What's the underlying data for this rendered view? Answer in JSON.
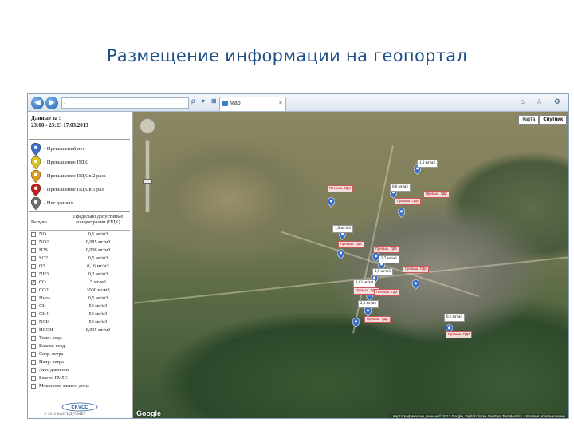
{
  "slide": {
    "title": "Размещение информации на геопортал"
  },
  "browser": {
    "address": ":",
    "address_icons": "ρ ▾ ⊠ ↻ ×",
    "tab_label": "Map",
    "tab_close": "×",
    "window_icons": "⌂ ☆ ⚙"
  },
  "legend": {
    "date_label": "Данные за :",
    "date_value": "23:00 - 23:23 17.03.2013",
    "items": [
      {
        "label": "- Превышений нет",
        "color": "#3a6fc9"
      },
      {
        "label": "- Превышение ПДК",
        "color": "#d9c21a"
      },
      {
        "label": "- Превышение ПДК в 2 раза",
        "color": "#e09a1a"
      },
      {
        "label": "- Превышение ПДК в 5 раз",
        "color": "#c6221c"
      },
      {
        "label": "- Нет данных",
        "color": "#6e6e6e"
      }
    ]
  },
  "pdk_table": {
    "col1": "Вещ-во",
    "col2": "Предельно допустимые концентрации (ПДК)",
    "rows": [
      {
        "name": "NO",
        "value": "0,1 мг/м3",
        "checked": false
      },
      {
        "name": "NO2",
        "value": "0,085 мг/м3",
        "checked": false
      },
      {
        "name": "H2S",
        "value": "0,008 мг/м3",
        "checked": false
      },
      {
        "name": "SO2",
        "value": "0,5 мг/м3",
        "checked": false
      },
      {
        "name": "O3",
        "value": "0,16 мг/м3",
        "checked": false
      },
      {
        "name": "NH3",
        "value": "0,2 мг/м3",
        "checked": false
      },
      {
        "name": "CO",
        "value": "5 мг/м3",
        "checked": true
      },
      {
        "name": "CO2",
        "value": "1000 мг/м3",
        "checked": false
      },
      {
        "name": "Пыль",
        "value": "0,5 мг/м3",
        "checked": false
      },
      {
        "name": "CH",
        "value": "50 мг/м3",
        "checked": false
      },
      {
        "name": "CH4",
        "value": "50 мг/м3",
        "checked": false
      },
      {
        "name": "NCH",
        "value": "50 мг/м3",
        "checked": false
      },
      {
        "name": "НСОН",
        "value": "0,035 мг/м3",
        "checked": false
      },
      {
        "name": "Темп. возд.",
        "value": "",
        "checked": false
      },
      {
        "name": "Влажн. возд.",
        "value": "",
        "checked": false
      },
      {
        "name": "Скор. ветра",
        "value": "",
        "checked": false
      },
      {
        "name": "Напр. ветра",
        "value": "",
        "checked": false
      },
      {
        "name": "Атм. давление",
        "value": "",
        "checked": false
      },
      {
        "name": "Бекгро PM5C",
        "value": "",
        "checked": false
      },
      {
        "name": "Мощность экспоз. дозы",
        "value": "",
        "checked": false
      }
    ]
  },
  "footer": {
    "logo": "CKVCC",
    "copyright": "© 2013 КАЗГИДРОМЕТ"
  },
  "map": {
    "type_buttons": [
      "Карта",
      "Спутник"
    ],
    "google_logo": "Google",
    "copyright": "Картографические данные © 2013 Google, Digital Globe, GeoEye, TerraMetrics · Условия использования",
    "callouts": [
      {
        "text": "1,6 мг/м3"
      },
      {
        "text": "0,6 мг/м3"
      },
      {
        "text": "1,0 мг/м3"
      },
      {
        "text": "3,7 мг/м3"
      },
      {
        "text": "1,9 мг/м3"
      },
      {
        "text": "1,03 мг/м3"
      },
      {
        "text": "2,3 мг/м3"
      },
      {
        "text": "0,1 мг/м3"
      }
    ],
    "tags": [
      {
        "text": "Превыш. ПДК"
      },
      {
        "text": "Превыш. ПДК"
      },
      {
        "text": "Превыш. ПДК"
      },
      {
        "text": "Превыш. ПДК"
      },
      {
        "text": "Превыш. ПДК"
      },
      {
        "text": "Превыш. ПДК"
      },
      {
        "text": "Превыш. ПДК"
      },
      {
        "text": "Превыш. ПДК"
      },
      {
        "text": "Превыш. ПДК"
      },
      {
        "text": "Превыш. ПДК"
      }
    ]
  }
}
